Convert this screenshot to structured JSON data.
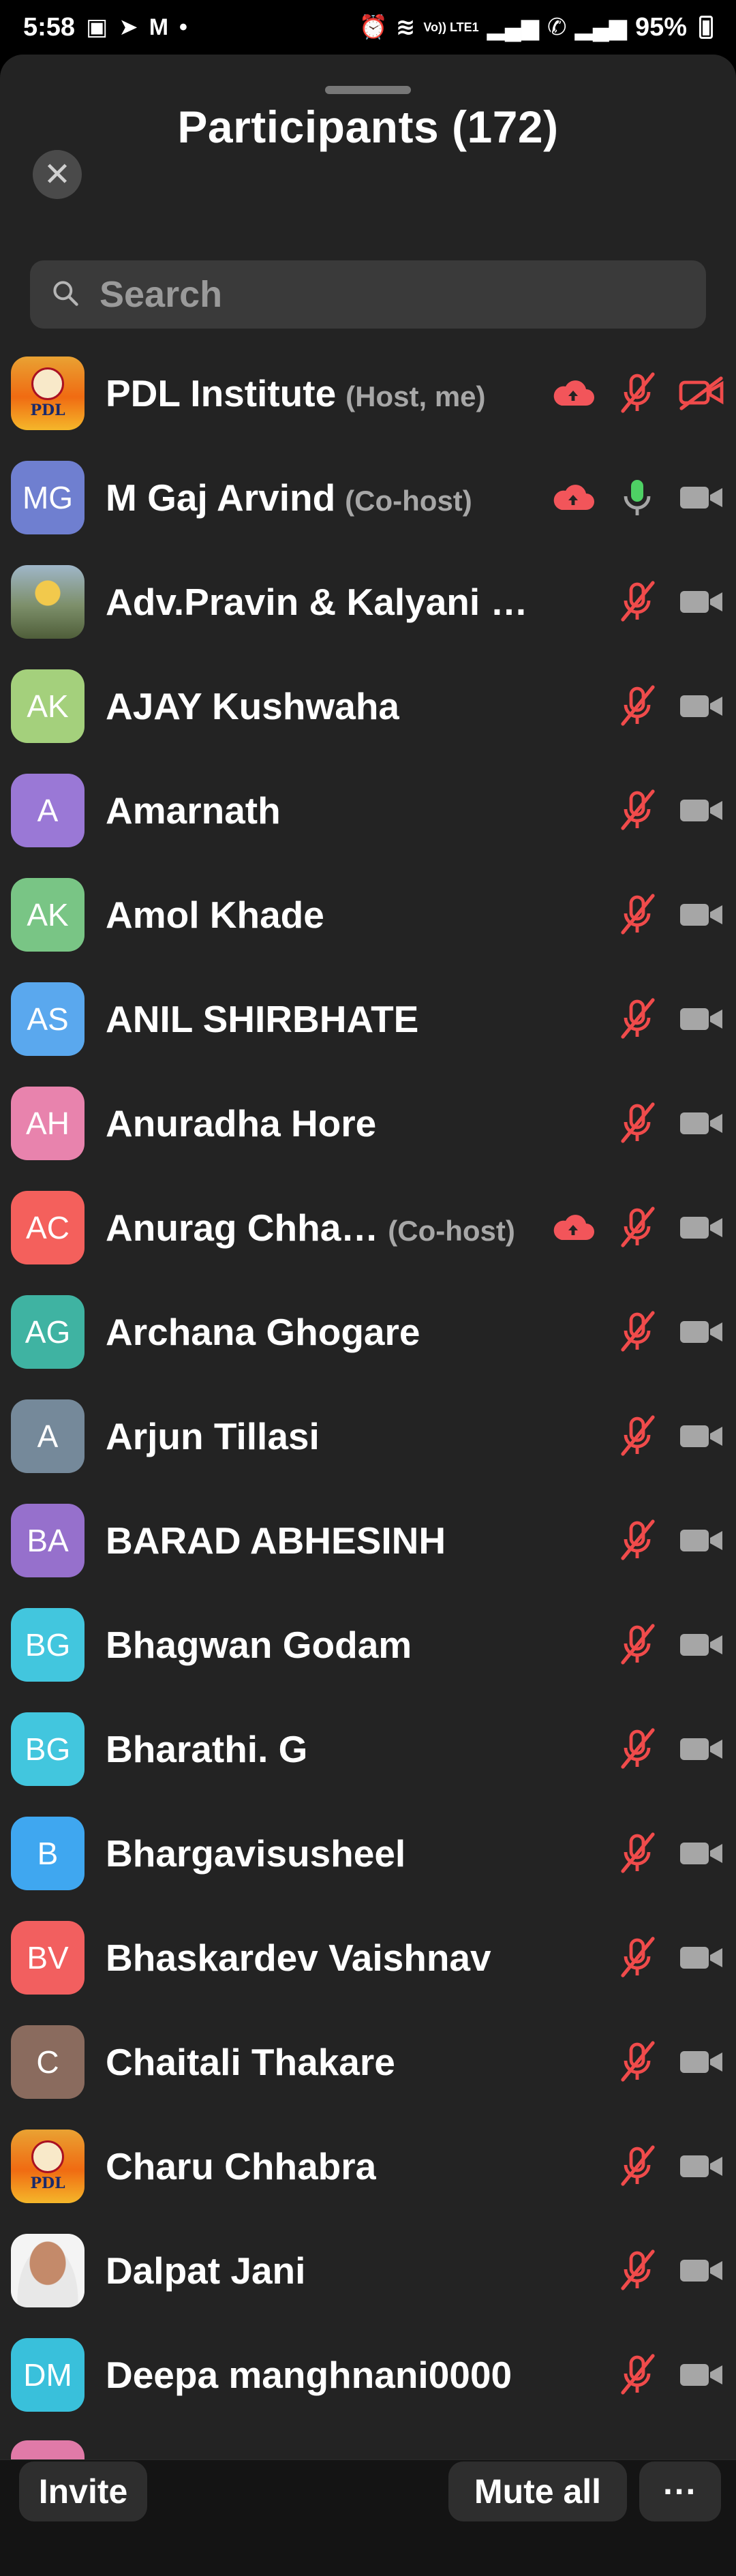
{
  "status_bar": {
    "time": "5:58",
    "network_label": "Vo)) LTE1",
    "battery": "95%"
  },
  "panel": {
    "title": "Participants (172)",
    "search_placeholder": "Search"
  },
  "participants": [
    {
      "initials": "",
      "avatar": "pdl-logo",
      "name": "PDL Institute",
      "role": "(Host, me)",
      "cloud": true,
      "mic": "muted",
      "video": "off"
    },
    {
      "initials": "MG",
      "color": "#6f7fd0",
      "name": "M Gaj Arvind",
      "role": "(Co-host)",
      "cloud": true,
      "mic": "on",
      "video": "gray"
    },
    {
      "initials": "",
      "avatar": "photo-man",
      "name": "Adv.Pravin & Kalyani Kh…",
      "role": "",
      "cloud": false,
      "mic": "muted",
      "video": "gray"
    },
    {
      "initials": "AK",
      "color": "#a4d07c",
      "name": "AJAY Kushwaha",
      "role": "",
      "cloud": false,
      "mic": "muted",
      "video": "gray"
    },
    {
      "initials": "A",
      "color": "#9a78d6",
      "name": "Amarnath",
      "role": "",
      "cloud": false,
      "mic": "muted",
      "video": "gray"
    },
    {
      "initials": "AK",
      "color": "#79c585",
      "name": "Amol Khade",
      "role": "",
      "cloud": false,
      "mic": "muted",
      "video": "gray"
    },
    {
      "initials": "AS",
      "color": "#5aa8ee",
      "name": "ANIL SHIRBHATE",
      "role": "",
      "cloud": false,
      "mic": "muted",
      "video": "gray"
    },
    {
      "initials": "AH",
      "color": "#e883ad",
      "name": "Anuradha Hore",
      "role": "",
      "cloud": false,
      "mic": "muted",
      "video": "gray"
    },
    {
      "initials": "AC",
      "color": "#f4605c",
      "name": "Anurag Chha…",
      "role": "(Co-host)",
      "cloud": true,
      "mic": "muted",
      "video": "gray"
    },
    {
      "initials": "AG",
      "color": "#3fb3a2",
      "name": "Archana Ghogare",
      "role": "",
      "cloud": false,
      "mic": "muted",
      "video": "gray"
    },
    {
      "initials": "A",
      "color": "#75899a",
      "name": "Arjun Tillasi",
      "role": "",
      "cloud": false,
      "mic": "muted",
      "video": "gray"
    },
    {
      "initials": "BA",
      "color": "#9670cc",
      "name": "BARAD ABHESINH",
      "role": "",
      "cloud": false,
      "mic": "muted",
      "video": "gray"
    },
    {
      "initials": "BG",
      "color": "#42c6de",
      "name": "Bhagwan Godam",
      "role": "",
      "cloud": false,
      "mic": "muted",
      "video": "gray"
    },
    {
      "initials": "BG",
      "color": "#42c6de",
      "name": "Bharathi. G",
      "role": "",
      "cloud": false,
      "mic": "muted",
      "video": "gray"
    },
    {
      "initials": "B",
      "color": "#3fa7f0",
      "name": "Bhargavisusheel",
      "role": "",
      "cloud": false,
      "mic": "muted",
      "video": "gray"
    },
    {
      "initials": "BV",
      "color": "#f25f5f",
      "name": "Bhaskardev Vaishnav",
      "role": "",
      "cloud": false,
      "mic": "muted",
      "video": "gray"
    },
    {
      "initials": "C",
      "color": "#8a6b5e",
      "name": "Chaitali Thakare",
      "role": "",
      "cloud": false,
      "mic": "muted",
      "video": "gray"
    },
    {
      "initials": "",
      "avatar": "pdl-logo",
      "name": "Charu Chhabra",
      "role": "",
      "cloud": false,
      "mic": "muted",
      "video": "gray"
    },
    {
      "initials": "",
      "avatar": "photo-face",
      "name": "Dalpat Jani",
      "role": "",
      "cloud": false,
      "mic": "muted",
      "video": "gray"
    },
    {
      "initials": "DM",
      "color": "#39c0db",
      "name": "Deepa manghnani0000",
      "role": "",
      "cloud": false,
      "mic": "muted",
      "video": "gray"
    }
  ],
  "bottom_bar": {
    "invite_label": "Invite",
    "mute_all_label": "Mute all",
    "more_label": "···"
  },
  "colors": {
    "muted_red": "#f04b4b",
    "mic_green": "#4ed164",
    "cloud_red": "#f2555a",
    "video_gray": "#a6a6a6"
  }
}
